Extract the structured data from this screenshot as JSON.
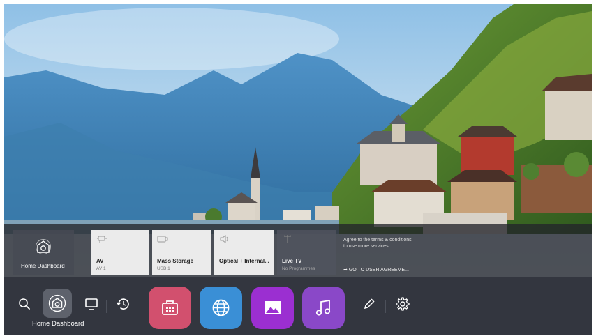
{
  "upper_bar": {
    "home_card": {
      "label": "Home Dashboard",
      "icon": "home-dashboard-icon"
    },
    "cards": [
      {
        "title": "AV",
        "subtitle": "AV 1",
        "icon": "av-cable-icon",
        "style": "light"
      },
      {
        "title": "Mass Storage",
        "subtitle": "USB 1",
        "icon": "usb-storage-icon",
        "style": "light"
      },
      {
        "title": "Optical + Internal...",
        "subtitle": "",
        "icon": "speaker-icon",
        "style": "light"
      },
      {
        "title": "Live TV",
        "subtitle": "No Programmes",
        "icon": "antenna-icon",
        "style": "dark"
      }
    ],
    "agree": {
      "text": "Agree to the terms & conditions to use more services.",
      "link": "GO TO USER AGREEME..."
    }
  },
  "launcher": {
    "search_icon": "search-icon",
    "home_label": "Home Dashboard",
    "items": [
      {
        "name": "live-tv",
        "icon": "tv-monitor-icon"
      },
      {
        "name": "recent",
        "icon": "recent-history-icon"
      }
    ],
    "apps": [
      {
        "name": "lg-content-store",
        "icon": "store-icon",
        "color": "#d2506e"
      },
      {
        "name": "web-browser",
        "icon": "globe-icon",
        "color": "#3a8fd6"
      },
      {
        "name": "photo-video",
        "icon": "image-icon",
        "color": "#9b2fd1"
      },
      {
        "name": "music",
        "icon": "music-note-icon",
        "color": "#8a48c8"
      }
    ],
    "edit_icon": "pencil-icon",
    "settings_icon": "gear-icon"
  }
}
